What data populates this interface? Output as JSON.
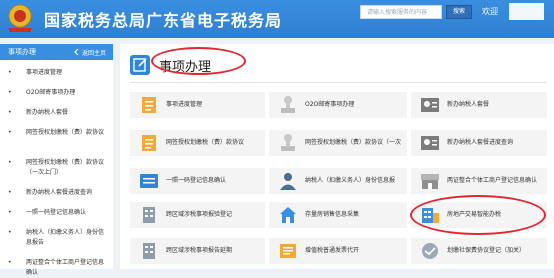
{
  "header": {
    "title": "国家税务总局广东省电子税务局",
    "search_placeholder": "请输入搜索服务的内容",
    "search_button": "搜索",
    "welcome": "欢迎"
  },
  "sidebar": {
    "title": "事项办理",
    "back_label": "返回主页",
    "items": [
      "事项进度管理",
      "O2O邮寄事项办理",
      "新办纳税人套餐",
      "网签授权划缴税（费）款协议",
      "网签授权划缴税（费）款协议（一次上门）",
      "新办纳税人套餐进度查询",
      "一照一码登记信息确认",
      "纳税人（扣缴义务人）身份信息报告",
      "两证整合个体工商户登记信息确认"
    ]
  },
  "main": {
    "section_title": "事项办理",
    "tiles": [
      {
        "label": "事项进度管理"
      },
      {
        "label": "O2O邮寄事项办理"
      },
      {
        "label": "新办纳税人套餐"
      },
      {
        "label": "网签授权划缴税（费）款协议"
      },
      {
        "label": "网签授权划缴税（费）款协议（一次"
      },
      {
        "label": "新办纳税人套餐进度查询"
      },
      {
        "label": "一照一码登记信息确认"
      },
      {
        "label": "纳税人（扣缴义务人）身份信息报"
      },
      {
        "label": "两证整合个体工商户登记信息确认"
      },
      {
        "label": "跨区域涉税事项报验登记"
      },
      {
        "label": "存量房销售信息采集"
      },
      {
        "label": "房地产交易智能办税"
      },
      {
        "label": "跨区域涉税事项报告延期"
      },
      {
        "label": "增值税普通发票代开"
      },
      {
        "label": "划缴社保费协议登记（加关）"
      }
    ]
  },
  "colors": {
    "header_bg": "#3a8ee0",
    "accent": "#2f86d8",
    "highlight_ring": "#e3262f"
  }
}
